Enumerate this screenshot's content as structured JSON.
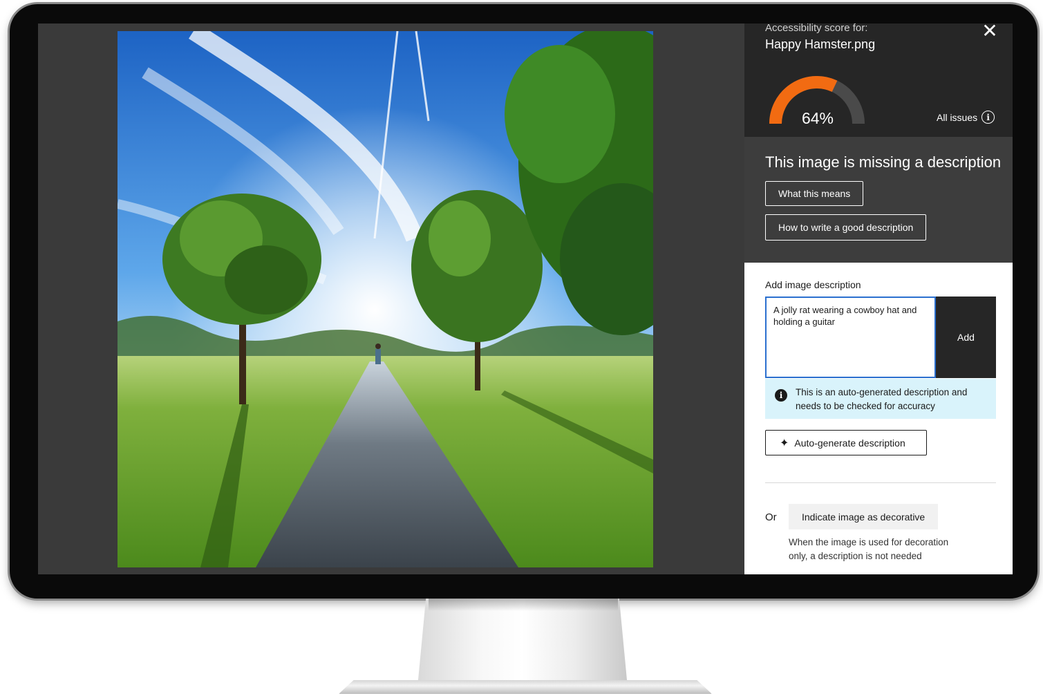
{
  "panel": {
    "score_label": "Accessibility score for:",
    "file_name": "Happy Hamster.png",
    "close_icon": "close-icon",
    "score": {
      "value": 64,
      "display": "64%",
      "color": "#f26b12"
    },
    "all_issues_label": "All issues",
    "missing_title": "This image is missing a description",
    "btn_what_means": "What this means",
    "btn_how_to": "How to write a good description"
  },
  "description": {
    "label": "Add image description",
    "value": "A jolly rat wearing a cowboy hat and holding a guitar",
    "add_button": "Add",
    "notice": "This is an auto-generated description and needs to be checked for accuracy",
    "autogen_button": "Auto-generate description"
  },
  "decorative": {
    "or_label": "Or",
    "button": "Indicate image as decorative",
    "help": "When the image is used for decoration only, a description is not needed"
  },
  "colors": {
    "accent_orange": "#f26b12",
    "input_focus": "#2a6fcf",
    "notice_bg": "#d9f3fb"
  }
}
